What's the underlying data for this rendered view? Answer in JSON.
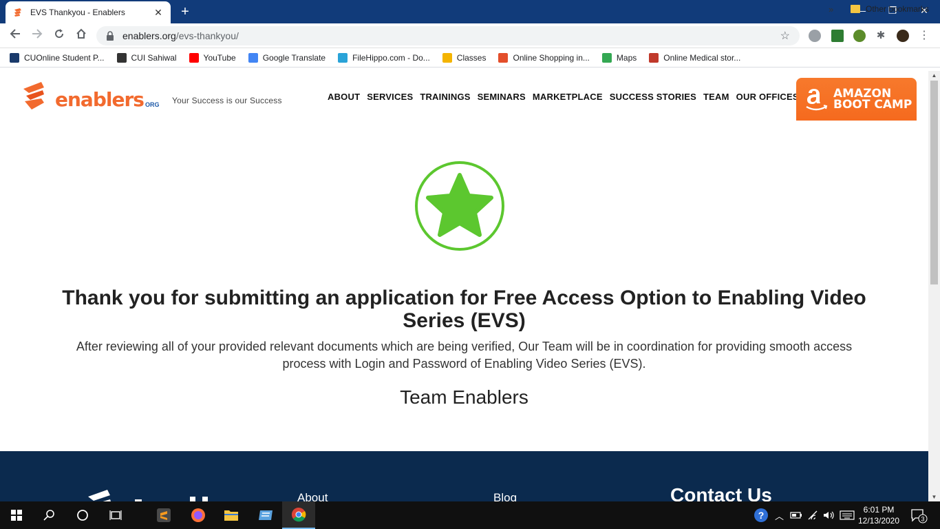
{
  "browser": {
    "tab_title": "EVS Thankyou - Enablers",
    "tab_close": "✕",
    "new_tab": "+",
    "window_controls": {
      "minimize": "—",
      "restore": "❐",
      "close": "✕"
    },
    "url_host": "enablers.org",
    "url_path": "/evs-thankyou/",
    "bookmarks": [
      {
        "label": "CUOnline Student P...",
        "color": "#1a3a6b"
      },
      {
        "label": "CUI Sahiwal",
        "color": "#333333"
      },
      {
        "label": "YouTube",
        "color": "#ff0000"
      },
      {
        "label": "Google Translate",
        "color": "#4285f4"
      },
      {
        "label": "FileHippo.com - Do...",
        "color": "#2aa3d8"
      },
      {
        "label": "Classes",
        "color": "#f4b400"
      },
      {
        "label": "Online Shopping in...",
        "color": "#e34e2b"
      },
      {
        "label": "Maps",
        "color": "#34a853"
      },
      {
        "label": "Online Medical stor...",
        "color": "#c0392b"
      }
    ],
    "bookmarks_more": "»",
    "other_bookmarks": "Other bookmarks"
  },
  "site": {
    "logo_text": "enablers",
    "logo_suffix": "ORG",
    "tagline": "Your Success is our Success",
    "nav": [
      "ABOUT",
      "SERVICES",
      "TRAININGS",
      "SEMINARS",
      "MARKETPLACE",
      "SUCCESS STORIES",
      "TEAM",
      "OUR OFFICES"
    ],
    "cta_line1": "AMAZON",
    "cta_line2": "BOOT CAMP",
    "brand_color": "#f26a2e",
    "badge_color": "#5cc72f"
  },
  "content": {
    "heading": "Thank you for submitting an application for Free Access Option to Enabling Video Series (EVS)",
    "body": "After reviewing all of your provided relevant documents which are being verified, Our Team will be in coordination for providing smooth access process with Login and Password of Enabling Video Series (EVS).",
    "signature": "Team Enablers"
  },
  "footer": {
    "col_about": "About",
    "col_blog": "Blog",
    "contact": "Contact Us"
  },
  "taskbar": {
    "time": "6:01 PM",
    "date": "12/13/2020",
    "notifications": "3"
  }
}
